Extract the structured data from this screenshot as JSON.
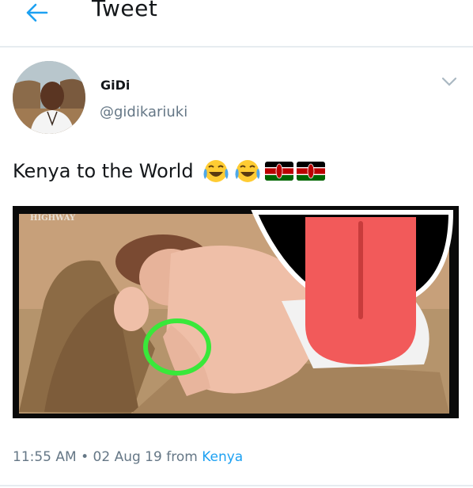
{
  "header": {
    "back_icon": "arrow-left-icon",
    "title": "Tweet"
  },
  "tweet": {
    "author": {
      "display_name": "GiDi",
      "handle": "@gidikariuki",
      "avatar_icon": "profile-photo"
    },
    "menu_icon": "chevron-down-icon",
    "text": "Kenya to the World",
    "emojis": [
      "face-with-tears-of-joy-icon",
      "face-with-tears-of-joy-icon",
      "kenya-flag-icon",
      "kenya-flag-icon"
    ],
    "media": {
      "watermark": "HIGHWAY",
      "overlay_icon": "tongue-icon",
      "annotation": "green-circle-highlight"
    },
    "timestamp": {
      "time": "11:55 AM",
      "separator": "•",
      "date": "02 Aug 19",
      "from_label": "from",
      "location": "Kenya"
    }
  },
  "colors": {
    "accent": "#1da1f2",
    "secondary_text": "#657786",
    "divider": "#e6ecf0",
    "highlight_circle": "#39e83a",
    "tongue": "#f25a5a"
  }
}
